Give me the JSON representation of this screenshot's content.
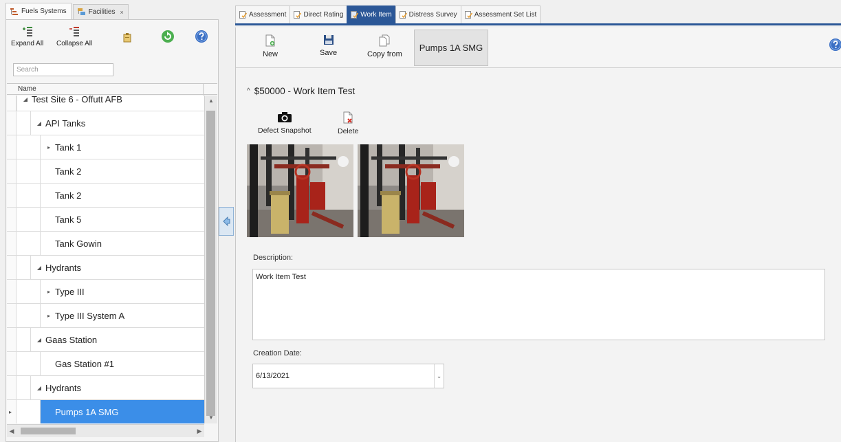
{
  "left_tabs": [
    {
      "label": "Fuels Systems",
      "active": true
    },
    {
      "label": "Facilities",
      "active": false,
      "closable": true,
      "close_glyph": "×"
    }
  ],
  "left_toolbar": {
    "expand_all": "Expand All",
    "collapse_all": "Collapse All"
  },
  "search": {
    "placeholder": "Search"
  },
  "tree": {
    "column_header": "Name",
    "rows": [
      {
        "label": "Test Site 6 - Offutt AFB",
        "level": 0,
        "expander": "◢",
        "selected": false
      },
      {
        "label": "API Tanks",
        "level": 1,
        "expander": "◢",
        "selected": false
      },
      {
        "label": "Tank 1",
        "level": 2,
        "expander": "▸",
        "selected": false
      },
      {
        "label": "Tank 2",
        "level": 2,
        "expander": "",
        "selected": false
      },
      {
        "label": "Tank 2",
        "level": 2,
        "expander": "",
        "selected": false
      },
      {
        "label": "Tank 5",
        "level": 2,
        "expander": "",
        "selected": false
      },
      {
        "label": "Tank Gowin",
        "level": 2,
        "expander": "",
        "selected": false
      },
      {
        "label": "Hydrants",
        "level": 1,
        "expander": "◢",
        "selected": false
      },
      {
        "label": "Type III",
        "level": 2,
        "expander": "▸",
        "selected": false
      },
      {
        "label": "Type III System A",
        "level": 2,
        "expander": "▸",
        "selected": false
      },
      {
        "label": "Gaas Station",
        "level": 1,
        "expander": "◢",
        "selected": false
      },
      {
        "label": "Gas Station #1",
        "level": 2,
        "expander": "",
        "selected": false
      },
      {
        "label": "Hydrants",
        "level": 1,
        "expander": "◢",
        "selected": false
      },
      {
        "label": "Pumps 1A SMG",
        "level": 2,
        "expander": "",
        "selected": true
      }
    ]
  },
  "right_tabs": [
    {
      "label": "Assessment",
      "active": false
    },
    {
      "label": "Direct Rating",
      "active": false
    },
    {
      "label": "Work Item",
      "active": true
    },
    {
      "label": "Distress Survey",
      "active": false
    },
    {
      "label": "Assessment Set List",
      "active": false
    }
  ],
  "right_toolbar": {
    "new": "New",
    "save": "Save",
    "copy_from": "Copy from",
    "context_item": "Pumps 1A SMG"
  },
  "work_item": {
    "title": "$50000 - Work Item Test",
    "defect_snapshot": "Defect Snapshot",
    "delete": "Delete",
    "description_label": "Description:",
    "description_value": "Work Item Test",
    "creation_date_label": "Creation Date:",
    "creation_date_value": "6/13/2021"
  },
  "colors": {
    "selection": "#3b8ee8",
    "active_tab": "#2b5797",
    "refresh_green": "#4caf50",
    "help_blue": "#3a6fc4"
  }
}
